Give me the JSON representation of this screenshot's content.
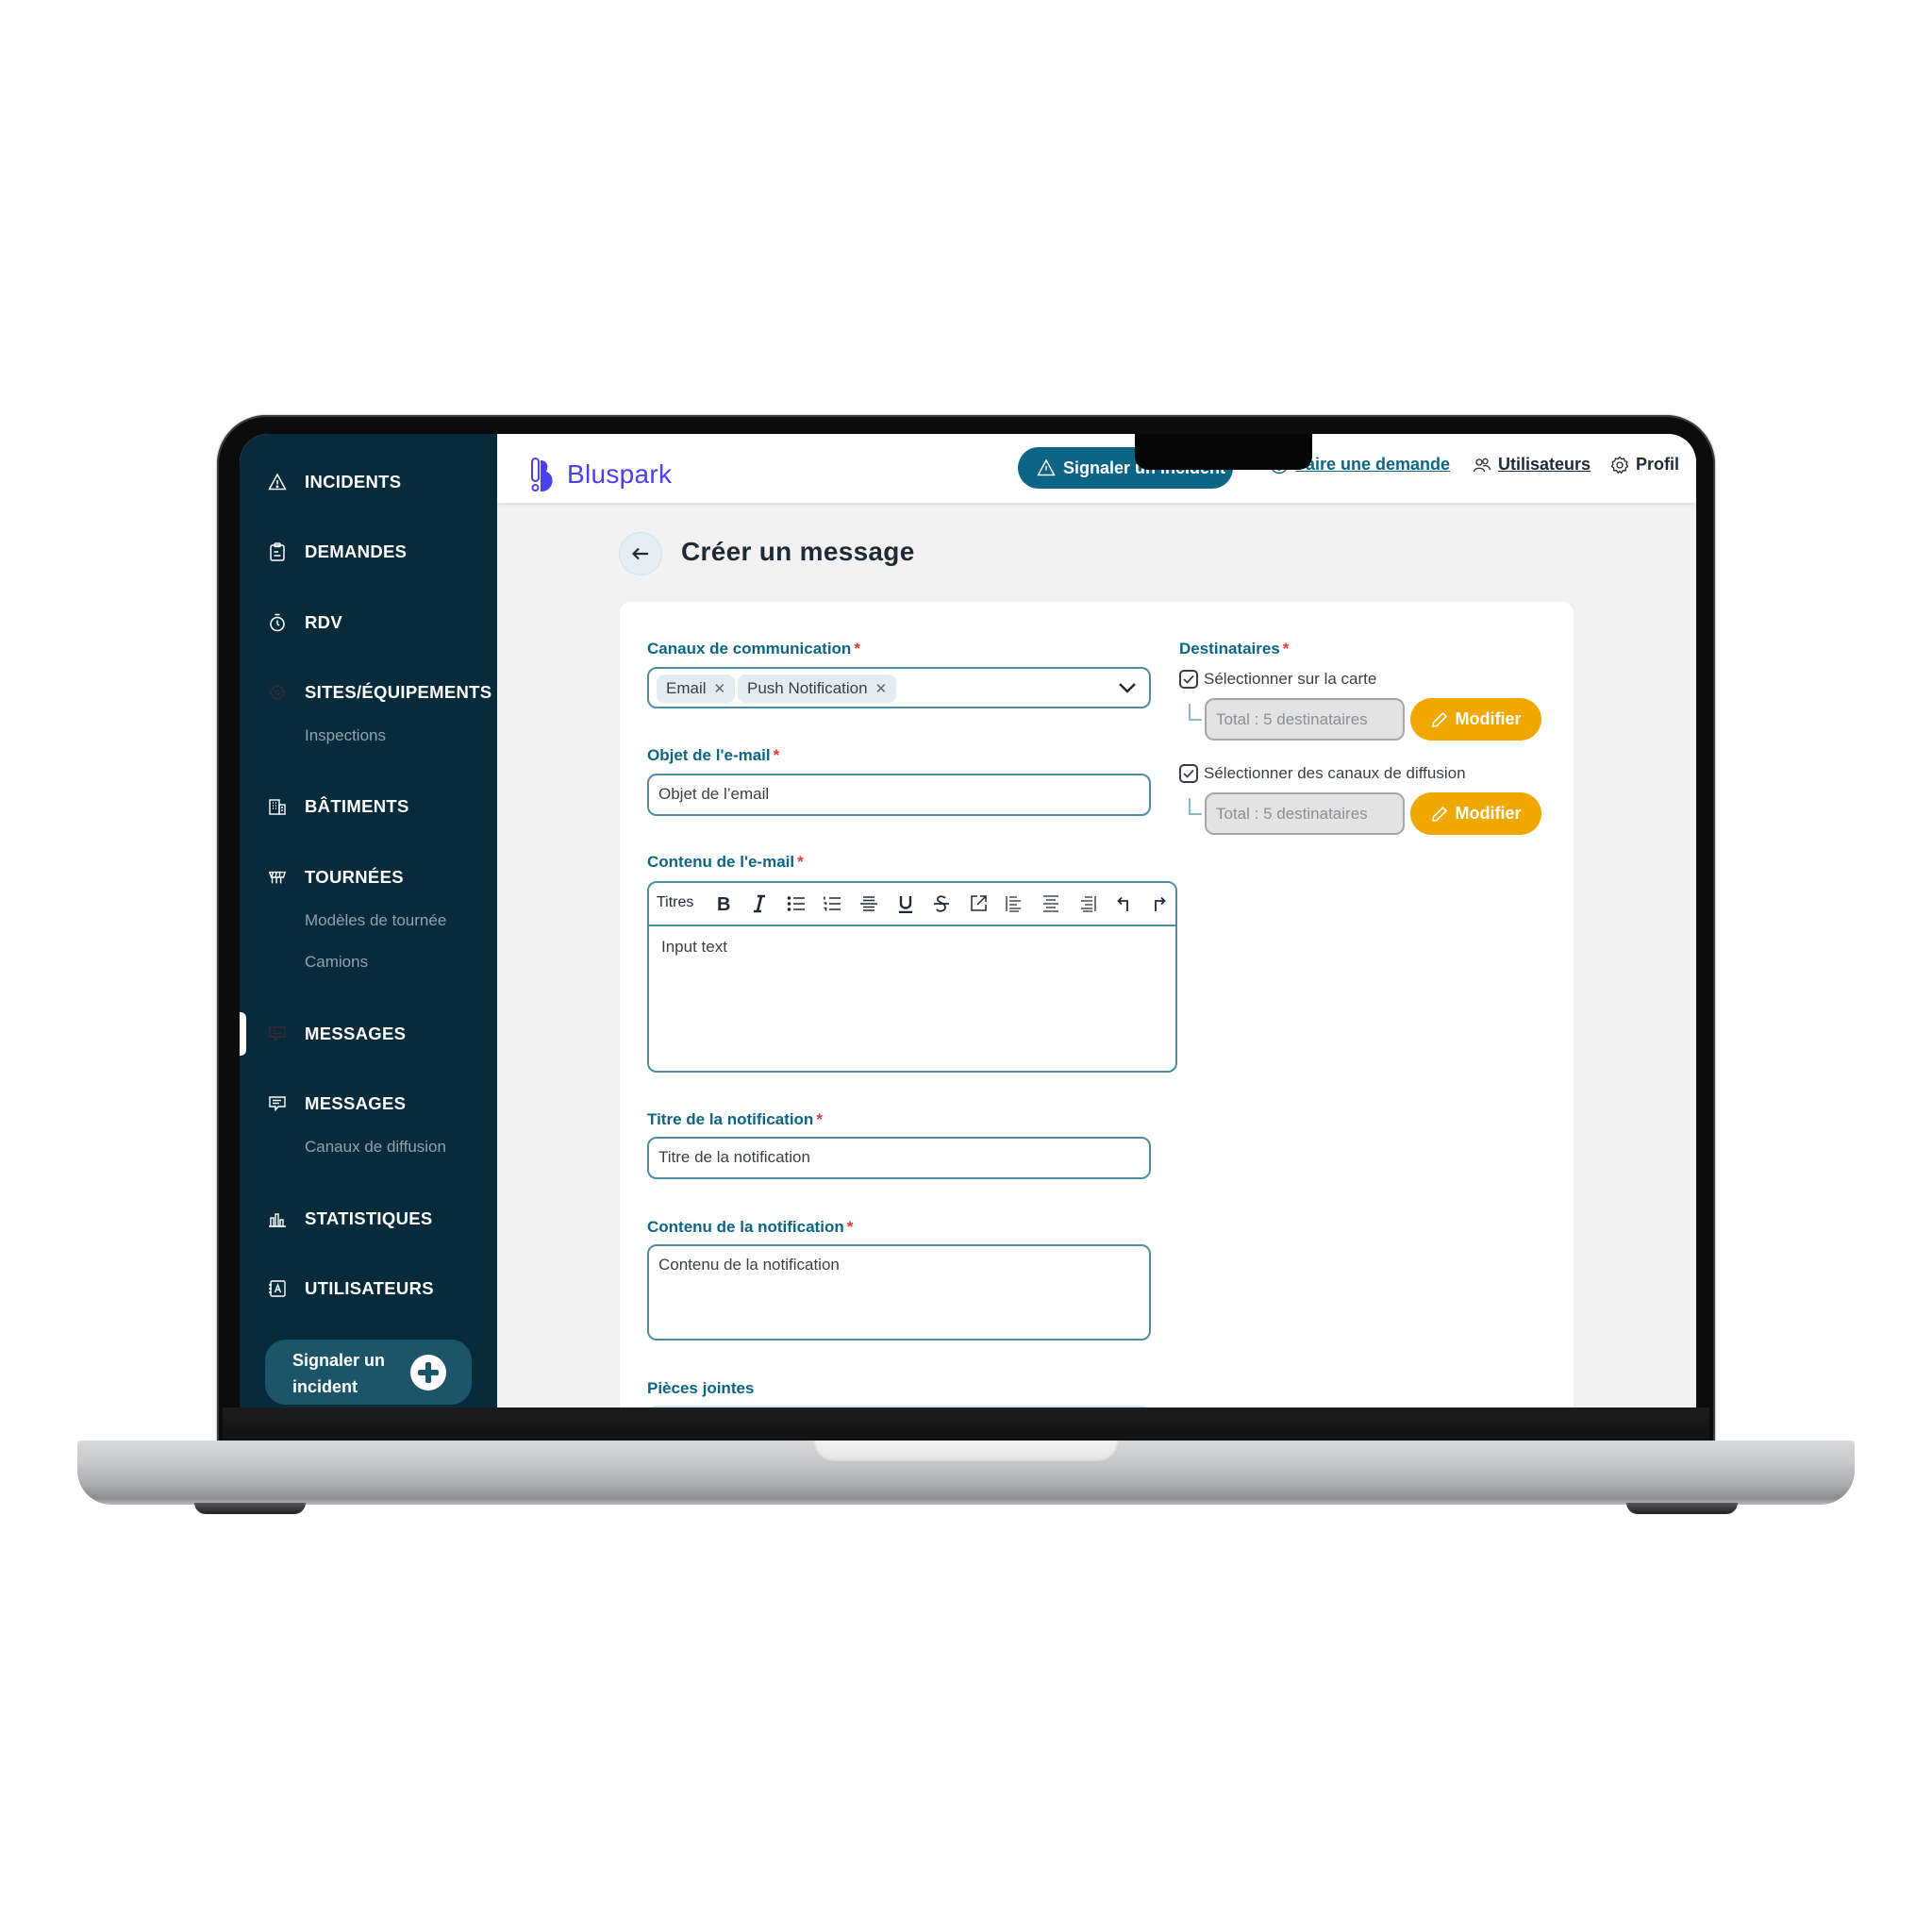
{
  "app": {
    "brand": "Bluspark",
    "colors": {
      "sidebar_bg": "#072b3a",
      "primary": "#0d6585",
      "brand": "#4b3ff0",
      "accent": "#f0a800",
      "required": "#e53935",
      "content_bg": "#f2f2f2"
    }
  },
  "sidebar": {
    "items": [
      {
        "label": "INCIDENTS",
        "icon": "warning-triangle-icon"
      },
      {
        "label": "DEMANDES",
        "icon": "clipboard-icon"
      },
      {
        "label": "RDV",
        "icon": "stopwatch-icon"
      },
      {
        "label": "SITES/ÉQUIPEMENTS",
        "icon": "target-icon",
        "sub": [
          "Inspections"
        ]
      },
      {
        "label": "BÂTIMENTS",
        "icon": "building-icon"
      },
      {
        "label": "TOURNÉES",
        "icon": "route-icon",
        "sub": [
          "Modèles de tournée",
          "Camions"
        ]
      },
      {
        "label": "MESSAGES",
        "icon": "chat-icon",
        "active": true
      },
      {
        "label": "MESSAGES",
        "icon": "chat-icon",
        "sub": [
          "Canaux de diffusion"
        ]
      },
      {
        "label": "STATISTIQUES",
        "icon": "bar-chart-icon"
      },
      {
        "label": "UTILISATEURS",
        "icon": "contact-card-icon"
      }
    ],
    "cta_label": "Signaler un incident"
  },
  "header": {
    "report_button": "Signaler un incident",
    "request_link": "Faire une demande",
    "users_link": "Utilisateurs",
    "profile_link": "Profil"
  },
  "page": {
    "title": "Créer un message",
    "back_icon": "arrow-left-icon"
  },
  "form": {
    "channels": {
      "label": "Canaux de communication",
      "selected": [
        "Email",
        "Push Notification"
      ]
    },
    "email_subject": {
      "label": "Objet de l'e-mail",
      "placeholder": "Objet de l’email"
    },
    "email_content": {
      "label": "Contenu de l'e-mail",
      "toolbar": {
        "headings_label": "Titres",
        "buttons": [
          "bold",
          "italic",
          "bullet-list",
          "numbered-list",
          "horizontal-rule",
          "underline",
          "strikethrough",
          "link",
          "align-left",
          "align-center",
          "align-right",
          "undo",
          "redo"
        ]
      },
      "placeholder": "Input text"
    },
    "notification_title": {
      "label": "Titre de la notification",
      "placeholder": "Titre de la notification"
    },
    "notification_content": {
      "label": "Contenu de la notification",
      "placeholder": "Contenu de la notification"
    },
    "attachments": {
      "label": "Pièces jointes"
    },
    "recipients": {
      "label": "Destinataires",
      "options": [
        {
          "label": "Sélectionner sur la carte",
          "checked": true,
          "total": "Total : 5 destinataires",
          "button": "Modifier"
        },
        {
          "label": "Sélectionner des canaux de diffusion",
          "checked": true,
          "total": "Total : 5 destinataires",
          "button": "Modifier"
        }
      ]
    },
    "required_mark": "*"
  }
}
